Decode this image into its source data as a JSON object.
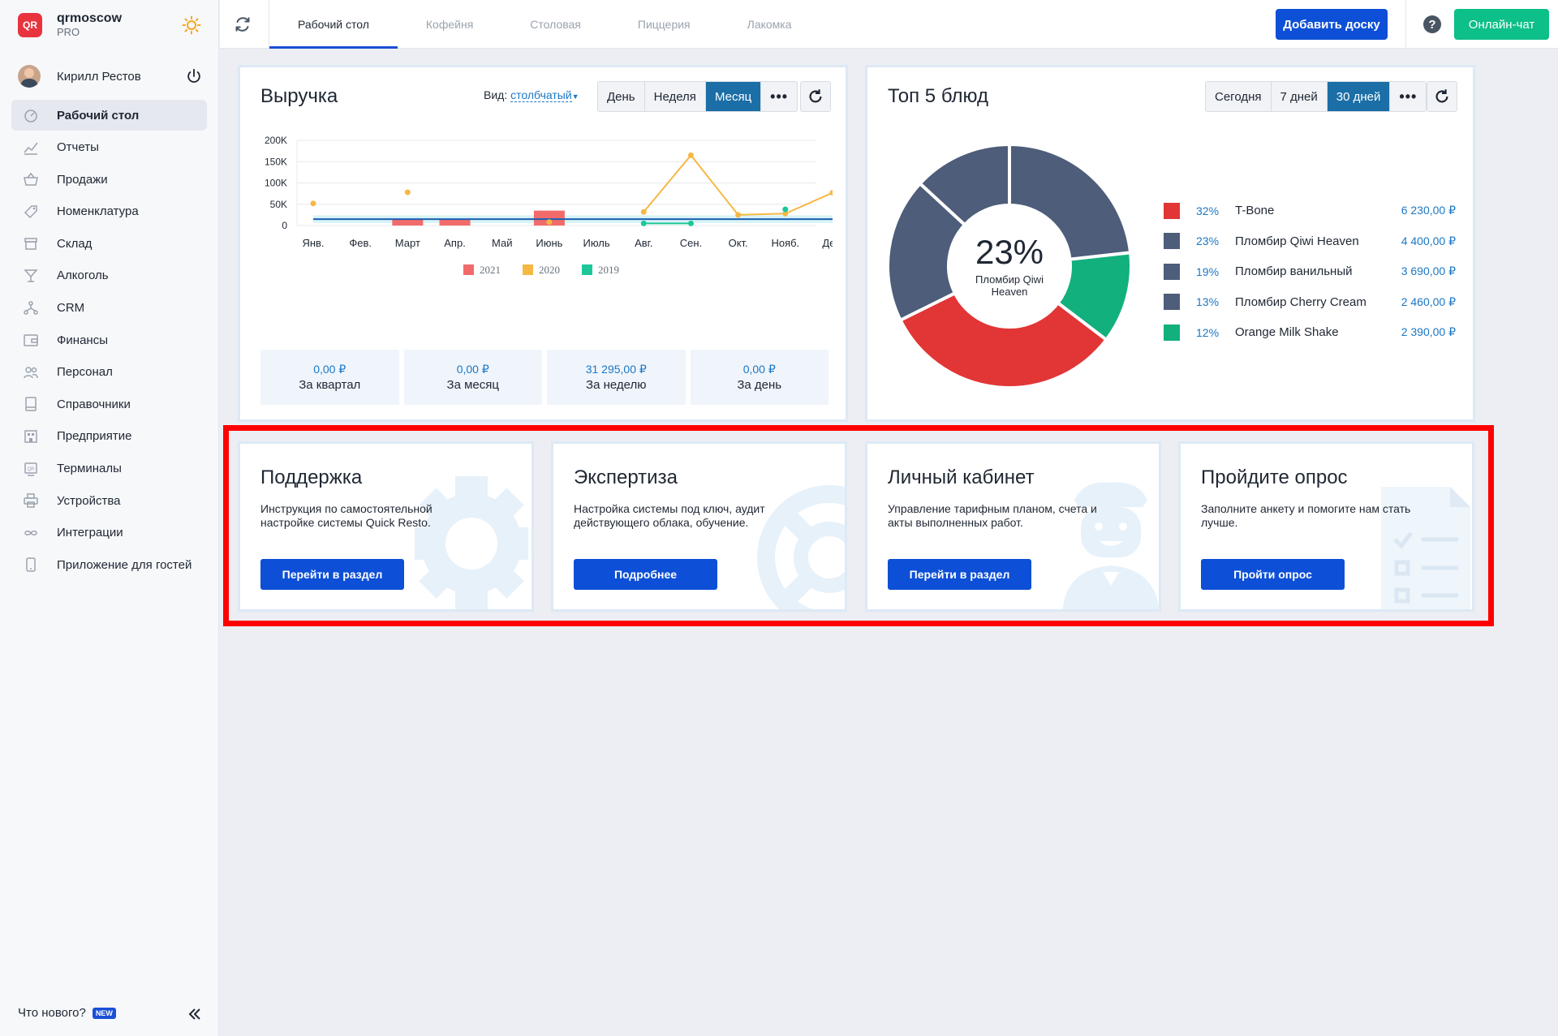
{
  "brand": {
    "name": "qrmoscow",
    "plan": "PRO",
    "logo_text": "QR"
  },
  "profile": {
    "name": "Кирилл Рестов"
  },
  "sidebar": {
    "items": [
      {
        "label": "Рабочий стол",
        "icon": "dashboard-icon",
        "active": true
      },
      {
        "label": "Отчеты",
        "icon": "chart-icon"
      },
      {
        "label": "Продажи",
        "icon": "basket-icon"
      },
      {
        "label": "Номенклатура",
        "icon": "tag-icon"
      },
      {
        "label": "Склад",
        "icon": "box-icon"
      },
      {
        "label": "Алкоголь",
        "icon": "glass-icon"
      },
      {
        "label": "CRM",
        "icon": "crm-icon"
      },
      {
        "label": "Финансы",
        "icon": "wallet-icon"
      },
      {
        "label": "Персонал",
        "icon": "people-icon"
      },
      {
        "label": "Справочники",
        "icon": "book-icon"
      },
      {
        "label": "Предприятие",
        "icon": "building-icon"
      },
      {
        "label": "Терминалы",
        "icon": "terminal-icon"
      },
      {
        "label": "Устройства",
        "icon": "printer-icon"
      },
      {
        "label": "Интеграции",
        "icon": "infinity-icon"
      },
      {
        "label": "Приложение для гостей",
        "icon": "phone-icon"
      }
    ],
    "whats_new": "Что нового?",
    "new_badge": "NEW"
  },
  "topbar": {
    "tabs": [
      {
        "label": "Рабочий стол",
        "active": true
      },
      {
        "label": "Кофейня"
      },
      {
        "label": "Столовая"
      },
      {
        "label": "Пиццерия"
      },
      {
        "label": "Лакомка"
      }
    ],
    "add_board": "Добавить доску",
    "chat": "Онлайн-чат"
  },
  "revenue": {
    "title": "Выручка",
    "view_label": "Вид:",
    "view_value": "столбчатый",
    "periods": [
      "День",
      "Неделя",
      "Месяц"
    ],
    "active_period": "Месяц",
    "stats": [
      {
        "value": "0,00 ₽",
        "label": "За квартал"
      },
      {
        "value": "0,00 ₽",
        "label": "За месяц"
      },
      {
        "value": "31 295,00 ₽",
        "label": "За неделю"
      },
      {
        "value": "0,00 ₽",
        "label": "За день"
      }
    ]
  },
  "chart_data": {
    "type": "bar",
    "categories": [
      "Янв.",
      "Фев.",
      "Март",
      "Апр.",
      "Май",
      "Июнь",
      "Июль",
      "Авг.",
      "Сен.",
      "Окт.",
      "Нояб.",
      "Дек."
    ],
    "ylim": [
      0,
      200000
    ],
    "yticks": [
      "0",
      "50K",
      "100K",
      "150K",
      "200K"
    ],
    "series": [
      {
        "name": "2021",
        "kind": "bar",
        "color": "#f26b6b",
        "values": [
          null,
          null,
          15000,
          15000,
          null,
          35000,
          null,
          null,
          null,
          null,
          null,
          null
        ]
      },
      {
        "name": "2020",
        "kind": "line",
        "color": "#f5b843",
        "values": [
          52000,
          null,
          78000,
          null,
          null,
          8000,
          null,
          32000,
          165000,
          25000,
          28000,
          77000
        ]
      },
      {
        "name": "2019",
        "kind": "line",
        "color": "#1dc79a",
        "values": [
          null,
          null,
          null,
          null,
          null,
          null,
          null,
          5000,
          5000,
          null,
          38000,
          null
        ]
      }
    ],
    "avg_line": 15000
  },
  "top5": {
    "title": "Топ 5 блюд",
    "periods": [
      "Сегодня",
      "7 дней",
      "30 дней"
    ],
    "active_period": "30 дней",
    "center_pct": "23%",
    "center_name": "Пломбир Qiwi Heaven",
    "items": [
      {
        "pct": "32%",
        "name": "T-Bone",
        "amount": "6 230,00 ₽",
        "color": "#e23535",
        "share": 32
      },
      {
        "pct": "23%",
        "name": "Пломбир Qiwi Heaven",
        "amount": "4 400,00 ₽",
        "color": "#4d5d7a",
        "share": 23
      },
      {
        "pct": "19%",
        "name": "Пломбир ванильный",
        "amount": "3 690,00 ₽",
        "color": "#4d5d7a",
        "share": 19
      },
      {
        "pct": "13%",
        "name": "Пломбир Cherry Cream",
        "amount": "2 460,00 ₽",
        "color": "#4d5d7a",
        "share": 13
      },
      {
        "pct": "12%",
        "name": "Orange Milk Shake",
        "amount": "2 390,00 ₽",
        "color": "#12b07d",
        "share": 12
      }
    ]
  },
  "info_cards": [
    {
      "title": "Поддержка",
      "desc": "Инструкция по самостоятельной настройке системы Quick Resto.",
      "button": "Перейти в раздел",
      "icon": "gear-icon"
    },
    {
      "title": "Экспертиза",
      "desc": "Настройка системы под ключ, аудит действующего облака, обучение.",
      "button": "Подробнее",
      "icon": "lifebuoy-icon"
    },
    {
      "title": "Личный кабинет",
      "desc": "Управление тарифным планом, счета и акты выполненных работ.",
      "button": "Перейти в раздел",
      "icon": "person-icon"
    },
    {
      "title": "Пройдите опрос",
      "desc": "Заполните анкету и помогите нам стать лучше.",
      "button": "Пройти опрос",
      "icon": "checklist-icon"
    }
  ]
}
